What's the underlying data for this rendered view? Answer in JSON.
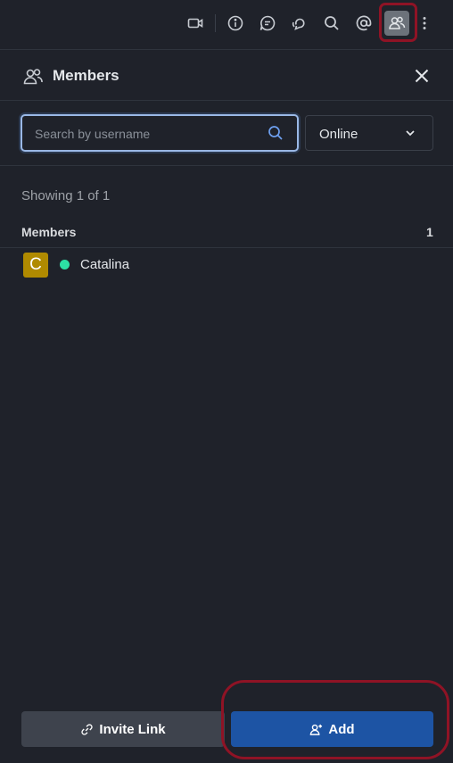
{
  "toolbar": {
    "icons": [
      "video-call-icon",
      "info-icon",
      "discussion-icon",
      "threads-icon",
      "search-icon",
      "mentions-icon",
      "members-icon",
      "kebab-menu-icon"
    ],
    "active_icon": "members-icon"
  },
  "panel": {
    "title": "Members",
    "close_icon": "close-icon"
  },
  "search": {
    "placeholder": "Search by username",
    "value": ""
  },
  "filter": {
    "selected": "Online"
  },
  "results": {
    "showing_text": "Showing 1 of 1"
  },
  "section": {
    "label": "Members",
    "count": "1"
  },
  "members": [
    {
      "initial": "C",
      "name": "Catalina",
      "status": "online",
      "avatar_color": "#b08a00",
      "status_color": "#2de0a5"
    }
  ],
  "footer": {
    "invite_label": "Invite Link",
    "add_label": "Add"
  },
  "colors": {
    "background": "#1f222a",
    "primary": "#1d54a4",
    "highlight": "#8f1325"
  }
}
